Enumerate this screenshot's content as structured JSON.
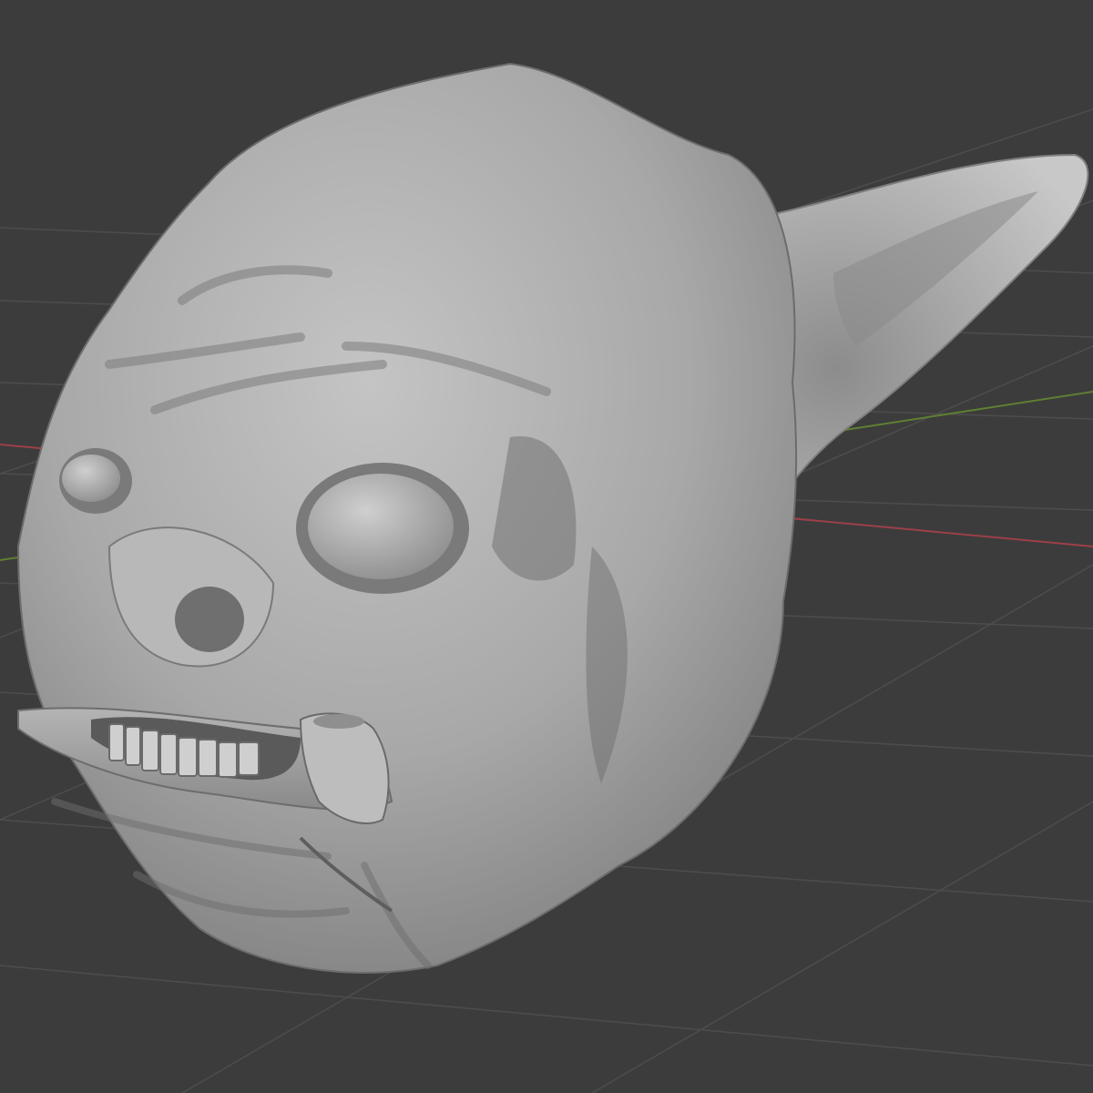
{
  "viewport": {
    "mode": "sculpt",
    "shading": "solid",
    "grid": true,
    "object": "goblin-head"
  },
  "colors": {
    "background": "#3c3c3c",
    "grid_line": "#4f4f4f",
    "x_axis": "#a8474f",
    "y_axis": "#6b8f3a",
    "mesh_base": "#9a9a9a",
    "mesh_light": "#c2c2c2",
    "mesh_shadow": "#5a5a5a"
  }
}
